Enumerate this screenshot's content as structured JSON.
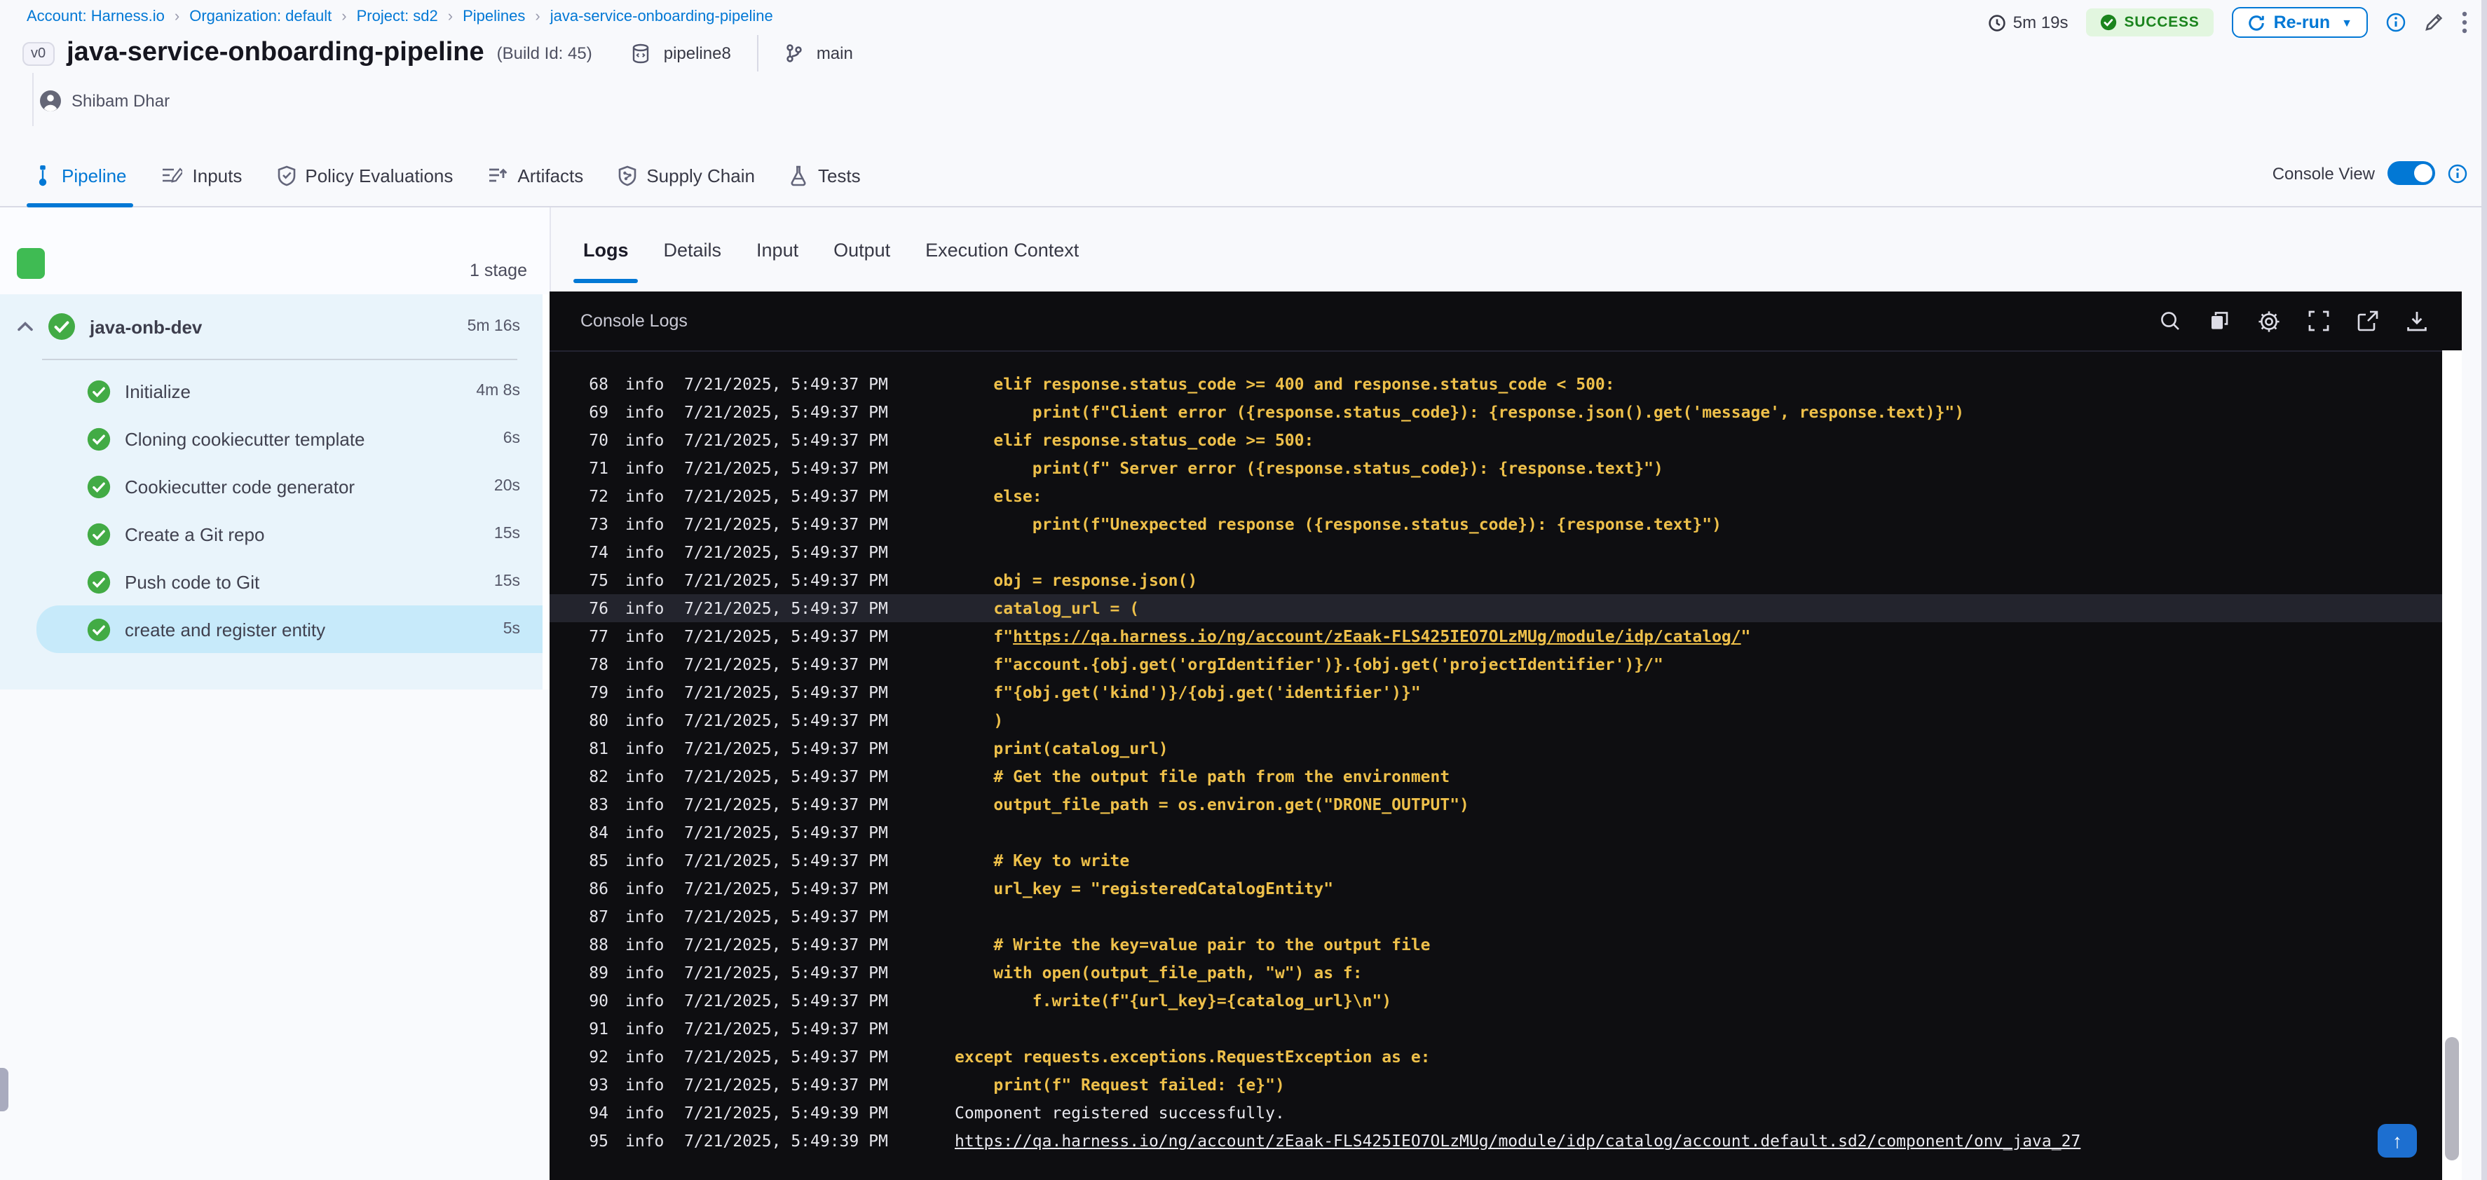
{
  "breadcrumb": {
    "items": [
      {
        "label": "Account: Harness.io"
      },
      {
        "label": "Organization: default"
      },
      {
        "label": "Project: sd2"
      },
      {
        "label": "Pipelines"
      },
      {
        "label": "java-service-onboarding-pipeline"
      }
    ]
  },
  "toolbar": {
    "duration": "5m 19s",
    "status": "SUCCESS",
    "rerun_label": "Re-run",
    "icons": [
      "clock-icon",
      "check-circle-icon",
      "refresh-icon",
      "info-icon",
      "pencil-icon",
      "kebab-menu-icon"
    ]
  },
  "header": {
    "version_badge": "v0",
    "title": "java-service-onboarding-pipeline",
    "build_id": "(Build Id: 45)",
    "pipeline_ref": "pipeline8",
    "branch": "main",
    "owner": "Shibam Dhar"
  },
  "tabs": [
    {
      "label": "Pipeline",
      "active": true
    },
    {
      "label": "Inputs",
      "active": false
    },
    {
      "label": "Policy Evaluations",
      "active": false
    },
    {
      "label": "Artifacts",
      "active": false
    },
    {
      "label": "Supply Chain",
      "active": false
    },
    {
      "label": "Tests",
      "active": false
    }
  ],
  "console_view": {
    "label": "Console View",
    "enabled": true
  },
  "sidebar": {
    "stage_count": "1 stage",
    "stage": {
      "name": "java-onb-dev",
      "duration": "5m 16s"
    },
    "steps": [
      {
        "name": "Initialize",
        "duration": "4m 8s",
        "selected": false
      },
      {
        "name": "Cloning cookiecutter template",
        "duration": "6s",
        "selected": false
      },
      {
        "name": "Cookiecutter code generator",
        "duration": "20s",
        "selected": false
      },
      {
        "name": "Create a Git repo",
        "duration": "15s",
        "selected": false
      },
      {
        "name": "Push code to Git",
        "duration": "15s",
        "selected": false
      },
      {
        "name": "create and register entity",
        "duration": "5s",
        "selected": true
      }
    ]
  },
  "log_tabs": [
    {
      "label": "Logs",
      "active": true
    },
    {
      "label": "Details",
      "active": false
    },
    {
      "label": "Input",
      "active": false
    },
    {
      "label": "Output",
      "active": false
    },
    {
      "label": "Execution Context",
      "active": false
    }
  ],
  "console": {
    "title": "Console Logs",
    "level_label": "info",
    "icons": [
      "search-icon",
      "copy-icon",
      "settings-icon",
      "fullscreen-icon",
      "open-in-new-icon",
      "download-icon"
    ],
    "scroll_top_icon": "up-arrow-icon"
  },
  "colors": {
    "accent_blue": "#0278d5",
    "success_green": "#42ab45",
    "log_yellow": "#eec04a",
    "console_bg": "#0e0e11",
    "sidebar_tree_bg": "#e9f4fb",
    "selected_step_bg": "#c7eafa"
  },
  "logs": [
    {
      "n": 68,
      "t": "7/21/2025, 5:49:37 PM",
      "c": "y",
      "seg": [
        {
          "x": "    elif response.status_code >= 400 and response.status_code < 500:"
        }
      ]
    },
    {
      "n": 69,
      "t": "7/21/2025, 5:49:37 PM",
      "c": "y",
      "seg": [
        {
          "x": "        print(f\"Client error ({response.status_code}): {response.json().get('message', response.text)}\")"
        }
      ]
    },
    {
      "n": 70,
      "t": "7/21/2025, 5:49:37 PM",
      "c": "y",
      "seg": [
        {
          "x": "    elif response.status_code >= 500:"
        }
      ]
    },
    {
      "n": 71,
      "t": "7/21/2025, 5:49:37 PM",
      "c": "y",
      "seg": [
        {
          "x": "        print(f\" Server error ({response.status_code}): {response.text}\")"
        }
      ]
    },
    {
      "n": 72,
      "t": "7/21/2025, 5:49:37 PM",
      "c": "y",
      "seg": [
        {
          "x": "    else:"
        }
      ]
    },
    {
      "n": 73,
      "t": "7/21/2025, 5:49:37 PM",
      "c": "y",
      "seg": [
        {
          "x": "        print(f\"Unexpected response ({response.status_code}): {response.text}\")"
        }
      ]
    },
    {
      "n": 74,
      "t": "7/21/2025, 5:49:37 PM",
      "c": "y",
      "seg": [
        {
          "x": ""
        }
      ]
    },
    {
      "n": 75,
      "t": "7/21/2025, 5:49:37 PM",
      "c": "y",
      "seg": [
        {
          "x": "    obj = response.json()"
        }
      ]
    },
    {
      "n": 76,
      "t": "7/21/2025, 5:49:37 PM",
      "c": "y",
      "hl": true,
      "seg": [
        {
          "x": "    catalog_url = ("
        }
      ]
    },
    {
      "n": 77,
      "t": "7/21/2025, 5:49:37 PM",
      "c": "y",
      "seg": [
        {
          "x": "    f\""
        },
        {
          "x": "https://qa.harness.io/ng/account/zEaak-FLS425IEO7OLzMUg/module/idp/catalog/",
          "u": true
        },
        {
          "x": "\""
        }
      ]
    },
    {
      "n": 78,
      "t": "7/21/2025, 5:49:37 PM",
      "c": "y",
      "seg": [
        {
          "x": "    f\"account.{obj.get('orgIdentifier')}.{obj.get('projectIdentifier')}/\""
        }
      ]
    },
    {
      "n": 79,
      "t": "7/21/2025, 5:49:37 PM",
      "c": "y",
      "seg": [
        {
          "x": "    f\"{obj.get('kind')}/{obj.get('identifier')}\""
        }
      ]
    },
    {
      "n": 80,
      "t": "7/21/2025, 5:49:37 PM",
      "c": "y",
      "seg": [
        {
          "x": "    )"
        }
      ]
    },
    {
      "n": 81,
      "t": "7/21/2025, 5:49:37 PM",
      "c": "y",
      "seg": [
        {
          "x": "    print(catalog_url)"
        }
      ]
    },
    {
      "n": 82,
      "t": "7/21/2025, 5:49:37 PM",
      "c": "y",
      "seg": [
        {
          "x": "    # Get the output file path from the environment"
        }
      ]
    },
    {
      "n": 83,
      "t": "7/21/2025, 5:49:37 PM",
      "c": "y",
      "seg": [
        {
          "x": "    output_file_path = os.environ.get(\"DRONE_OUTPUT\")"
        }
      ]
    },
    {
      "n": 84,
      "t": "7/21/2025, 5:49:37 PM",
      "c": "y",
      "seg": [
        {
          "x": ""
        }
      ]
    },
    {
      "n": 85,
      "t": "7/21/2025, 5:49:37 PM",
      "c": "y",
      "seg": [
        {
          "x": "    # Key to write"
        }
      ]
    },
    {
      "n": 86,
      "t": "7/21/2025, 5:49:37 PM",
      "c": "y",
      "seg": [
        {
          "x": "    url_key = \"registeredCatalogEntity\""
        }
      ]
    },
    {
      "n": 87,
      "t": "7/21/2025, 5:49:37 PM",
      "c": "y",
      "seg": [
        {
          "x": ""
        }
      ]
    },
    {
      "n": 88,
      "t": "7/21/2025, 5:49:37 PM",
      "c": "y",
      "seg": [
        {
          "x": "    # Write the key=value pair to the output file"
        }
      ]
    },
    {
      "n": 89,
      "t": "7/21/2025, 5:49:37 PM",
      "c": "y",
      "seg": [
        {
          "x": "    with open(output_file_path, \"w\") as f:"
        }
      ]
    },
    {
      "n": 90,
      "t": "7/21/2025, 5:49:37 PM",
      "c": "y",
      "seg": [
        {
          "x": "        f.write(f\"{url_key}={catalog_url}\\n\")"
        }
      ]
    },
    {
      "n": 91,
      "t": "7/21/2025, 5:49:37 PM",
      "c": "y",
      "seg": [
        {
          "x": ""
        }
      ]
    },
    {
      "n": 92,
      "t": "7/21/2025, 5:49:37 PM",
      "c": "y",
      "seg": [
        {
          "x": "except requests.exceptions.RequestException as e:"
        }
      ]
    },
    {
      "n": 93,
      "t": "7/21/2025, 5:49:37 PM",
      "c": "y",
      "seg": [
        {
          "x": "    print(f\" Request failed: {e}\")"
        }
      ]
    },
    {
      "n": 94,
      "t": "7/21/2025, 5:49:39 PM",
      "c": "w",
      "seg": [
        {
          "x": "Component registered successfully."
        }
      ]
    },
    {
      "n": 95,
      "t": "7/21/2025, 5:49:39 PM",
      "c": "w",
      "seg": [
        {
          "x": "https://qa.harness.io/ng/account/zEaak-FLS425IEO7OLzMUg/module/idp/catalog/account.default.sd2/component/onv_java_27",
          "u": true
        }
      ]
    }
  ]
}
